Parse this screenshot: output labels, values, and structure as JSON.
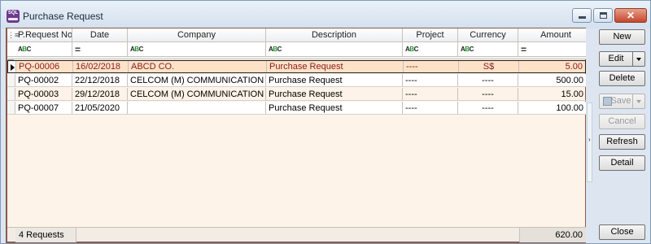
{
  "window": {
    "title": "Purchase Request",
    "icon_text": "SQL",
    "icon": "app-logo-icon",
    "controls": [
      "minimize-icon",
      "maximize-icon",
      "close-icon"
    ]
  },
  "grid": {
    "columns": [
      {
        "key": "no",
        "label": "P.Request No",
        "filter": "abc"
      },
      {
        "key": "date",
        "label": "Date",
        "filter": "eq"
      },
      {
        "key": "company",
        "label": "Company",
        "filter": "abc"
      },
      {
        "key": "desc",
        "label": "Description",
        "filter": "abc"
      },
      {
        "key": "project",
        "label": "Project",
        "filter": "abc"
      },
      {
        "key": "currency",
        "label": "Currency",
        "filter": "abc"
      },
      {
        "key": "amount",
        "label": "Amount",
        "filter": "eq"
      }
    ],
    "filter_text": {
      "abc_prefix": "A",
      "abc_b": "B",
      "abc_c": "C",
      "eq": "="
    },
    "rows": [
      {
        "no": "PQ-00006",
        "date": "16/02/2018",
        "company": "ABCD CO.",
        "desc": "Purchase Request",
        "project": "----",
        "currency": "S$",
        "amount": "5.00"
      },
      {
        "no": "PQ-00002",
        "date": "22/12/2018",
        "company": "CELCOM (M) COMMUNICATION BHD",
        "desc": "Purchase Request",
        "project": "----",
        "currency": "----",
        "amount": "500.00"
      },
      {
        "no": "PQ-00003",
        "date": "29/12/2018",
        "company": "CELCOM (M) COMMUNICATION BHD",
        "desc": "Purchase Request",
        "project": "----",
        "currency": "----",
        "amount": "15.00"
      },
      {
        "no": "PQ-00007",
        "date": "21/05/2020",
        "company": "",
        "desc": "Purchase Request",
        "project": "----",
        "currency": "----",
        "amount": "100.00"
      }
    ],
    "selected_row": 0,
    "footer": {
      "count": "4 Requests",
      "total": "620.00"
    }
  },
  "actions": {
    "new": "New",
    "edit": "Edit",
    "delete": "Delete",
    "save": "Save",
    "cancel": "Cancel",
    "refresh": "Refresh",
    "detail": "Detail",
    "close": "Close"
  },
  "colors": {
    "grid_bg": "#fdf3e8",
    "selected_row": "#fde2c8",
    "selected_text": "#8b1a1a",
    "filter_green": "#1f8f28"
  }
}
